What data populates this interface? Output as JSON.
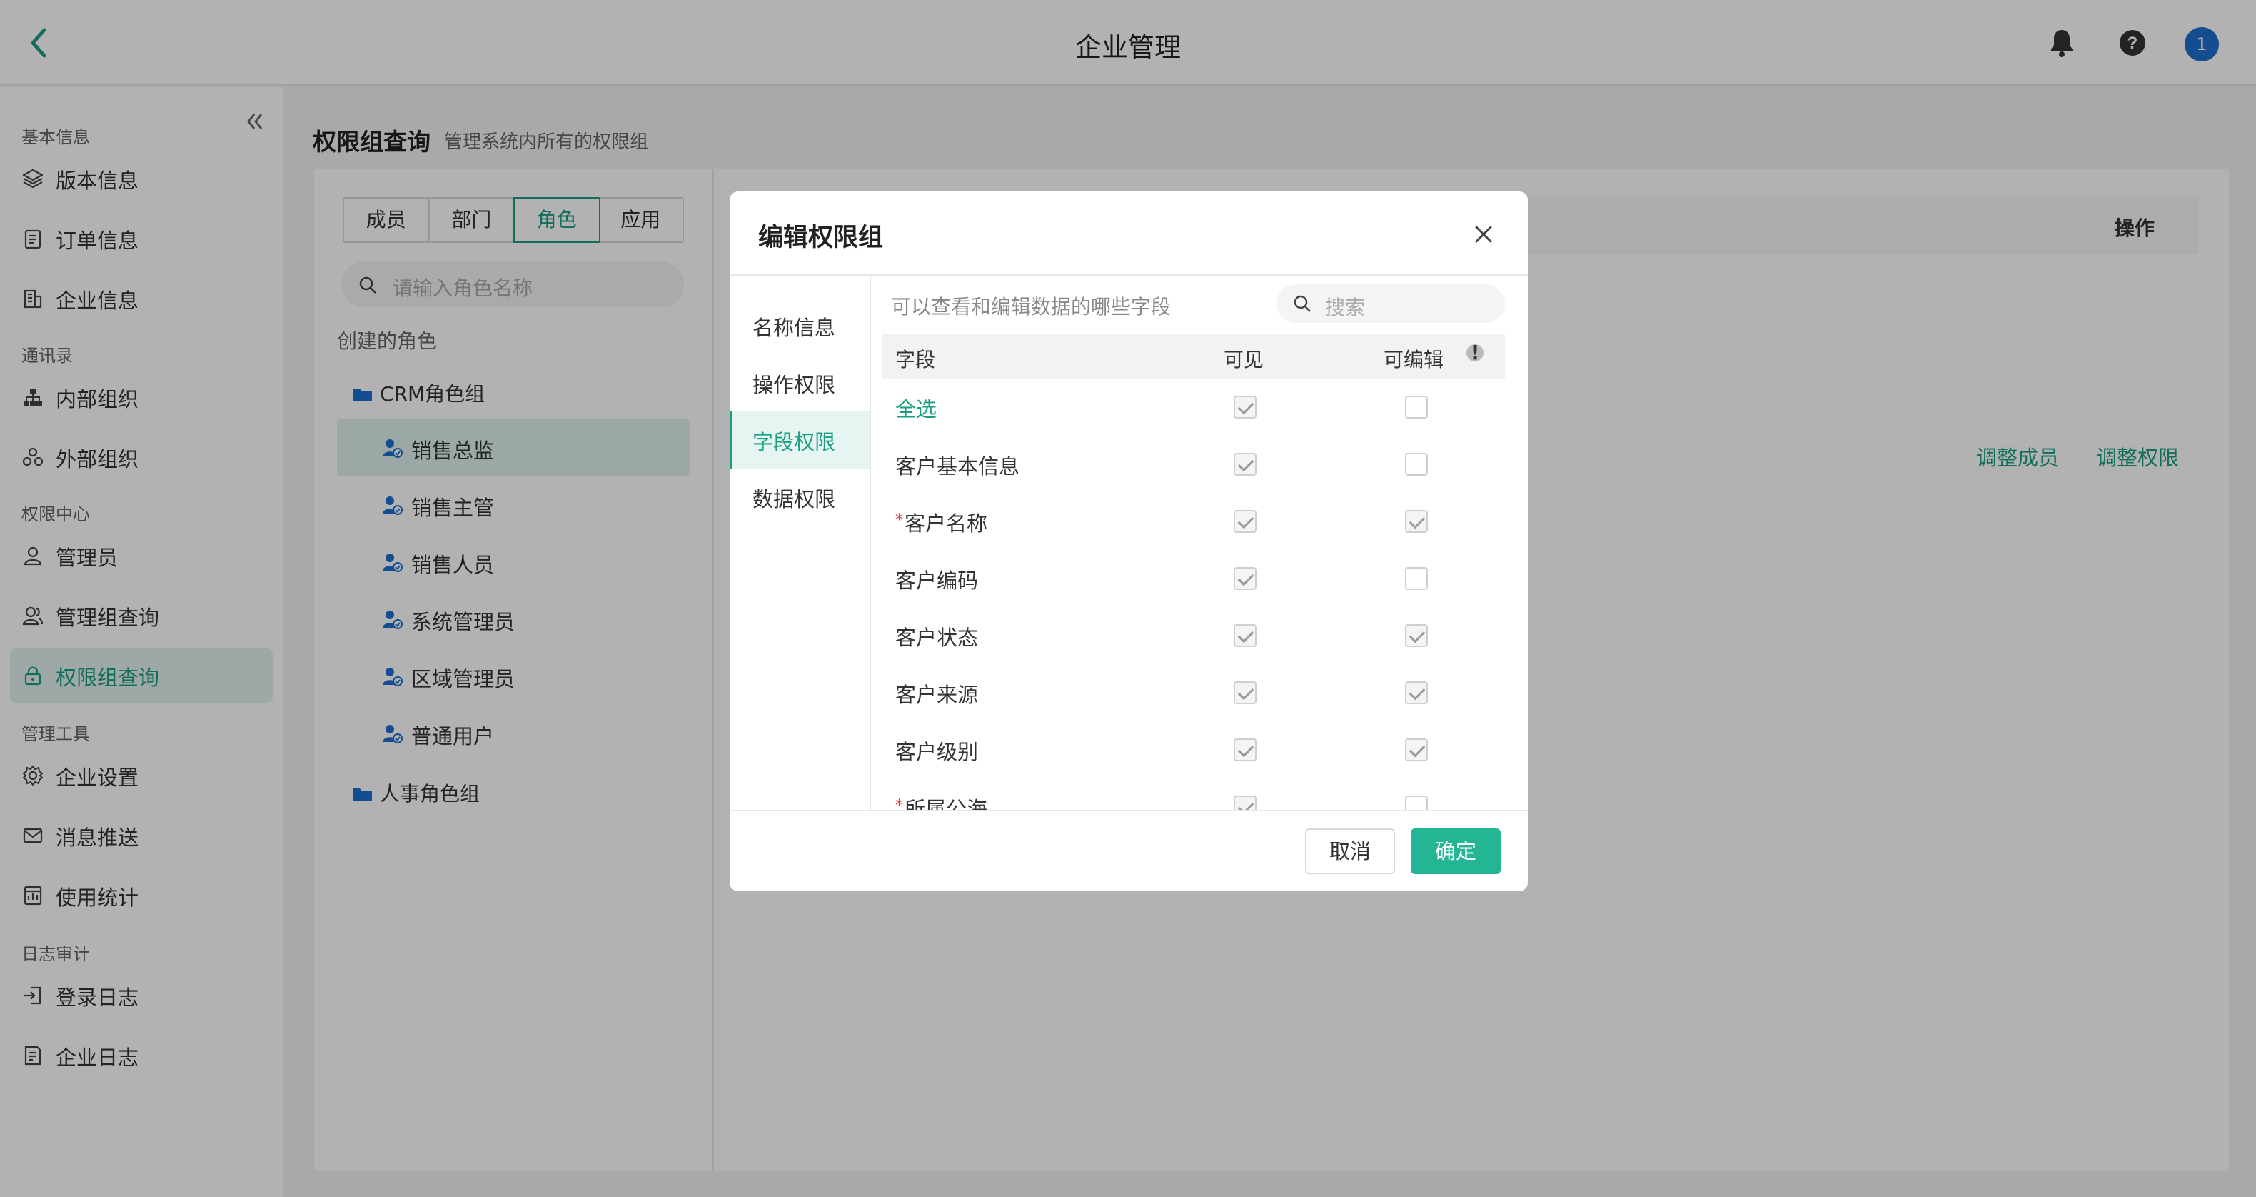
{
  "app": {
    "title": "企业管理",
    "avatar_text": "1",
    "accent_color": "#1a9e84"
  },
  "sidebar": {
    "groups": [
      "基本信息",
      "通讯录",
      "权限中心",
      "管理工具",
      "日志审计"
    ],
    "items": [
      {
        "label": "版本信息",
        "icon": "layers-icon"
      },
      {
        "label": "订单信息",
        "icon": "clipboard-icon"
      },
      {
        "label": "企业信息",
        "icon": "building-icon"
      },
      {
        "label": "内部组织",
        "icon": "org-tree-icon"
      },
      {
        "label": "外部组织",
        "icon": "external-org-icon"
      },
      {
        "label": "管理员",
        "icon": "user-icon"
      },
      {
        "label": "管理组查询",
        "icon": "user-group-icon"
      },
      {
        "label": "权限组查询",
        "icon": "lock-icon"
      },
      {
        "label": "企业设置",
        "icon": "gear-icon"
      },
      {
        "label": "消息推送",
        "icon": "mail-icon"
      },
      {
        "label": "使用统计",
        "icon": "stats-icon"
      },
      {
        "label": "登录日志",
        "icon": "login-icon"
      },
      {
        "label": "企业日志",
        "icon": "log-file-icon"
      }
    ]
  },
  "main": {
    "title": "权限组查询",
    "subtitle": "管理系统内所有的权限组",
    "tabs": [
      "成员",
      "部门",
      "角色",
      "应用"
    ],
    "active_tab": "角色",
    "search_placeholder": "请输入角色名称",
    "tree_caption": "创建的角色",
    "tree": {
      "folder1": "CRM角色组",
      "roles": [
        "销售总监",
        "销售主管",
        "销售人员",
        "系统管理员",
        "区域管理员",
        "普通用户"
      ],
      "folder2": "人事角色组"
    },
    "table": {
      "op_header": "操作",
      "actions": [
        "调整成员",
        "调整权限"
      ]
    }
  },
  "modal": {
    "title": "编辑权限组",
    "nav": [
      "名称信息",
      "操作权限",
      "字段权限",
      "数据权限"
    ],
    "active_nav": "字段权限",
    "hint": "可以查看和编辑数据的哪些字段",
    "search_placeholder": "搜索",
    "headers": {
      "field": "字段",
      "visible": "可见",
      "editable": "可编辑"
    },
    "rows": [
      {
        "name": "全选",
        "required": false,
        "visible": true,
        "editable": false
      },
      {
        "name": "客户基本信息",
        "required": false,
        "visible": true,
        "editable": false
      },
      {
        "name": "客户名称",
        "required": true,
        "visible": true,
        "editable": true
      },
      {
        "name": "客户编码",
        "required": false,
        "visible": true,
        "editable": false
      },
      {
        "name": "客户状态",
        "required": false,
        "visible": true,
        "editable": true
      },
      {
        "name": "客户来源",
        "required": false,
        "visible": true,
        "editable": true
      },
      {
        "name": "客户级别",
        "required": false,
        "visible": true,
        "editable": true
      },
      {
        "name": "所属公海",
        "required": true,
        "visible": true,
        "editable": false
      }
    ],
    "cancel_label": "取消",
    "ok_label": "确定"
  }
}
